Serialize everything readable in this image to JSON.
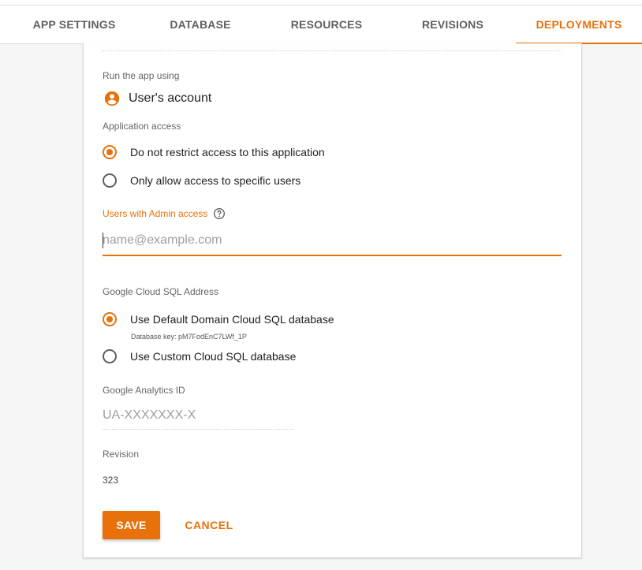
{
  "tabs": [
    {
      "label": "APP SETTINGS",
      "active": false
    },
    {
      "label": "DATABASE",
      "active": false
    },
    {
      "label": "RESOURCES",
      "active": false
    },
    {
      "label": "REVISIONS",
      "active": false
    },
    {
      "label": "DEPLOYMENTS",
      "active": true
    }
  ],
  "run_as": {
    "label": "Run the app using",
    "value": "User's account",
    "icon": "account-circle-icon"
  },
  "access": {
    "label": "Application access",
    "options": [
      {
        "label": "Do not restrict access to this application",
        "selected": true
      },
      {
        "label": "Only allow access to specific users",
        "selected": false
      }
    ]
  },
  "admin": {
    "label": "Users with Admin access",
    "placeholder": "name@example.com",
    "value": "",
    "help_icon": "help-circle-icon"
  },
  "sql": {
    "label": "Google Cloud SQL Address",
    "options": [
      {
        "label": "Use Default Domain Cloud SQL database",
        "selected": true
      },
      {
        "label": "Use Custom Cloud SQL database",
        "selected": false
      }
    ],
    "database_key": "Database key: pM7FodEnC7LWf_1P"
  },
  "analytics": {
    "label": "Google Analytics ID",
    "placeholder": "UA-XXXXXXX-X",
    "value": ""
  },
  "revision": {
    "label": "Revision",
    "value": "323"
  },
  "actions": {
    "save": "SAVE",
    "cancel": "CANCEL"
  },
  "colors": {
    "accent": "#e8710a",
    "tab_inactive": "#5f5f5f",
    "background": "#f5f5f5"
  }
}
